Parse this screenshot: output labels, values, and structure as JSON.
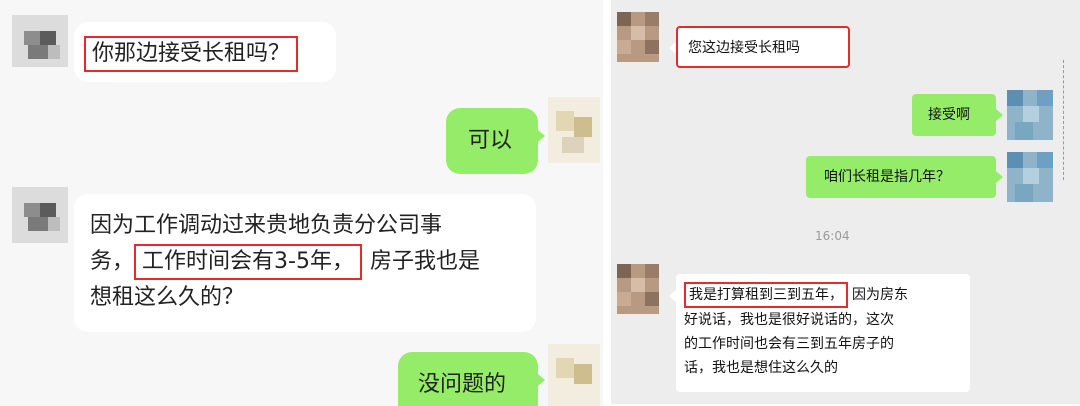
{
  "left_chat": {
    "messages": [
      {
        "lines": [
          "你那边接受长租吗？"
        ]
      },
      {
        "lines": [
          "可以"
        ]
      },
      {
        "line1": "因为工作调动过来贵地负责分公司事",
        "line2_pre": "务，",
        "line2_box": "工作时间会有3-5年，",
        "line2_post": "房子我也是",
        "line3": "想租这么久的？"
      },
      {
        "lines": [
          "没问题的"
        ]
      }
    ]
  },
  "right_chat": {
    "timestamp": "16:04",
    "messages": [
      {
        "text": "您这边接受长租吗"
      },
      {
        "text": "接受啊"
      },
      {
        "text": "咱们长租是指几年？"
      },
      {
        "box": "我是打算租到三到五年，",
        "line1_rest": "因为房东",
        "line2": "好说话，我也是很好说话的，这次",
        "line3": "的工作时间也会有三到五年房子的",
        "line4": "话，我也是想住这么久的"
      }
    ]
  },
  "colors": {
    "incoming": "#ffffff",
    "outgoing": "#95ec69",
    "highlight": "#e52b2b"
  }
}
